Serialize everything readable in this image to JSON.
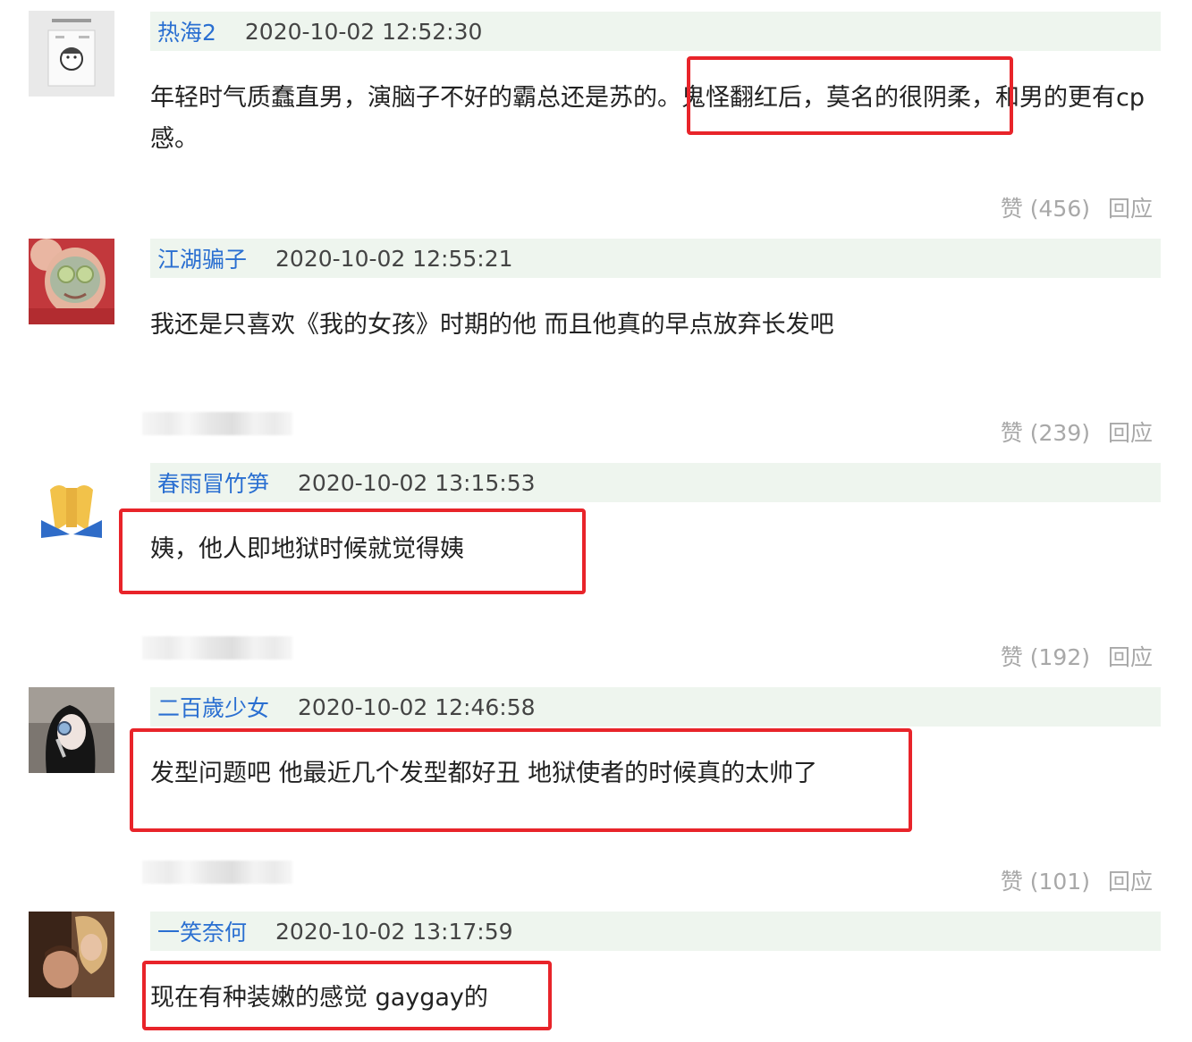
{
  "comments": [
    {
      "username": "热海2",
      "timestamp": "2020-10-02 12:52:30",
      "text_before": "年轻时气质蠢直男，演脑子不好的霸总还是苏的。",
      "text_highlight": "鬼怪翻红后，莫名的很阴柔",
      "text_after": "，和男的更有cp感。",
      "likes": "赞 (456)",
      "reply": "回应"
    },
    {
      "username": "江湖骗子",
      "timestamp": "2020-10-02 12:55:21",
      "text": "我还是只喜欢《我的女孩》时期的他 而且他真的早点放弃长发吧",
      "likes": "赞 (239)",
      "reply": "回应"
    },
    {
      "username": "春雨冒竹笋",
      "timestamp": "2020-10-02 13:15:53",
      "text": "姨，他人即地狱时候就觉得姨",
      "likes": "赞 (192)",
      "reply": "回应"
    },
    {
      "username": "二百歲少女",
      "timestamp": "2020-10-02 12:46:58",
      "text": "发型问题吧 他最近几个发型都好丑 地狱使者的时候真的太帅了",
      "likes": "赞 (101)",
      "reply": "回应"
    },
    {
      "username": "一笑奈何",
      "timestamp": "2020-10-02 13:17:59",
      "text": "现在有种装嫩的感觉 gaygay的"
    }
  ],
  "colors": {
    "username": "#2a6fd1",
    "meta_bar": "#eef5ee",
    "highlight_box": "#e8242a",
    "action_text": "#a8a8a8"
  }
}
